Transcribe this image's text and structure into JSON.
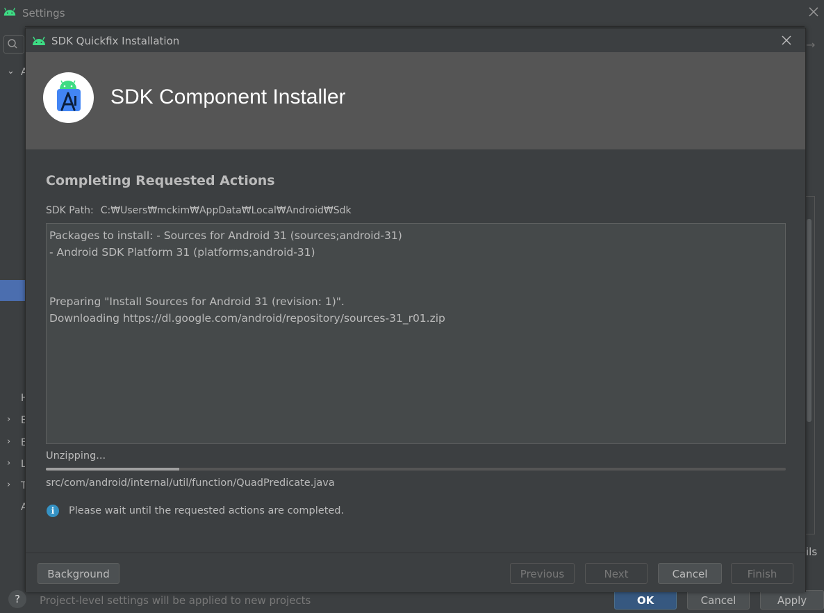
{
  "background_window": {
    "title": "Settings",
    "sidebar_letters": [
      "A",
      "H",
      "E",
      "E",
      "L",
      "T",
      "A"
    ],
    "details_fragment": "ils",
    "hint": "Project-level settings will be applied to new projects",
    "help_label": "?",
    "ok_label": "OK",
    "cancel_label": "Cancel",
    "apply_label": "Apply"
  },
  "dialog": {
    "title": "SDK Quickfix Installation",
    "banner_title": "SDK Component Installer",
    "heading": "Completing Requested Actions",
    "sdk_path_label": "SDK Path:",
    "sdk_path_value": "C:₩Users₩mckim₩AppData₩Local₩Android₩Sdk",
    "log_lines": [
      "Packages to install: - Sources for Android 31 (sources;android-31)",
      "- Android SDK Platform 31 (platforms;android-31)",
      "",
      "",
      "Preparing \"Install Sources for Android 31 (revision: 1)\".",
      "Downloading https://dl.google.com/android/repository/sources-31_r01.zip"
    ],
    "status": "Unzipping...",
    "progress_fraction": 0.18,
    "current_file": "src/com/android/internal/util/function/QuadPredicate.java",
    "info_message": "Please wait until the requested actions are completed.",
    "buttons": {
      "background": "Background",
      "previous": "Previous",
      "next": "Next",
      "cancel": "Cancel",
      "finish": "Finish"
    }
  },
  "colors": {
    "accent_blue": "#365880",
    "selection_blue": "#4b6eaf",
    "android_green": "#3ddc84",
    "info_blue": "#3592c4"
  }
}
